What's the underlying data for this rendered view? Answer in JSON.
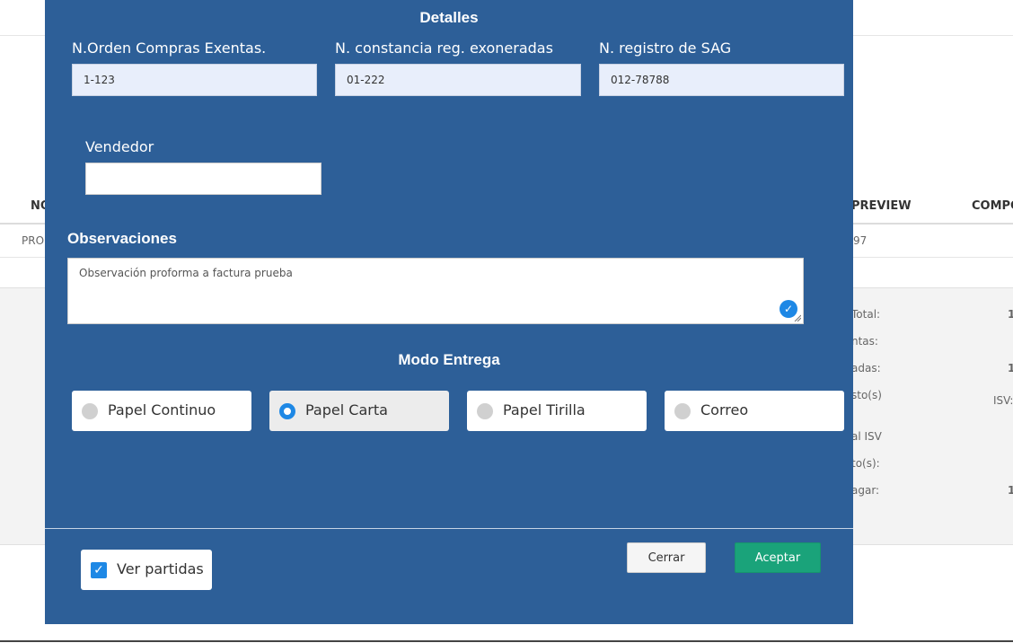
{
  "background": {
    "table_headers": [
      "NO",
      "PREVIEW",
      "COMPO"
    ],
    "row_cells": [
      "PRO",
      "97"
    ],
    "summary_labels": [
      "Total:",
      "ntas:",
      "adas:",
      "sto(s)",
      "al ISV",
      "to(s):",
      "agar:"
    ],
    "summary_values": [
      "1",
      "1",
      "ISV:",
      "1"
    ]
  },
  "modal": {
    "title": "Detalles",
    "fields": [
      {
        "label": "N.Orden Compras Exentas.",
        "value": "1-123"
      },
      {
        "label": "N. constancia reg. exoneradas",
        "value": "01-222"
      },
      {
        "label": "N. registro de SAG",
        "value": "012-78788"
      }
    ],
    "vendedor": {
      "label": "Vendedor",
      "value": ""
    },
    "observaciones": {
      "title": "Observaciones",
      "value": "Observación proforma a factura prueba"
    },
    "modo_entrega": {
      "title": "Modo Entrega",
      "options": [
        {
          "label": "Papel Continuo",
          "selected": false
        },
        {
          "label": "Papel Carta",
          "selected": true
        },
        {
          "label": "Papel Tirilla",
          "selected": false
        },
        {
          "label": "Correo",
          "selected": false
        }
      ]
    },
    "footer": {
      "ver_partidas": {
        "label": "Ver partidas",
        "checked": true
      },
      "cerrar_label": "Cerrar",
      "aceptar_label": "Aceptar"
    }
  },
  "colors": {
    "modal_bg": "#2d5f98",
    "accent_blue": "#1e88e5",
    "accept_green": "#1aa37a"
  }
}
